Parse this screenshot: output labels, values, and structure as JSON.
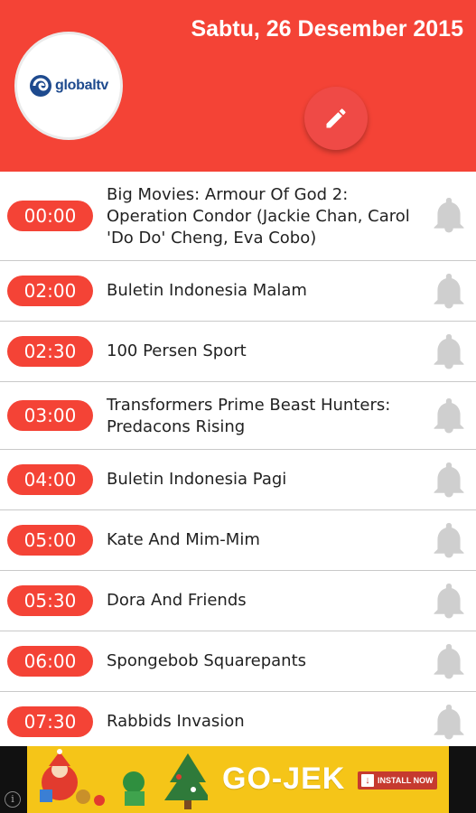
{
  "header": {
    "date": "Sabtu, 26 Desember 2015",
    "channel_logo": "globaltv",
    "edit_icon": "pencil-icon",
    "color": "#f44336"
  },
  "schedule": [
    {
      "time": "00:00",
      "title": "Big Movies: Armour Of God 2: Operation Condor (Jackie Chan, Carol 'Do Do' Cheng, Eva Cobo)"
    },
    {
      "time": "02:00",
      "title": "Buletin Indonesia Malam"
    },
    {
      "time": "02:30",
      "title": "100 Persen Sport"
    },
    {
      "time": "03:00",
      "title": "Transformers Prime Beast Hunters: Predacons Rising"
    },
    {
      "time": "04:00",
      "title": "Buletin Indonesia Pagi"
    },
    {
      "time": "05:00",
      "title": "Kate And Mim-Mim"
    },
    {
      "time": "05:30",
      "title": "Dora And Friends"
    },
    {
      "time": "06:00",
      "title": "Spongebob Squarepants"
    },
    {
      "time": "07:30",
      "title": "Rabbids Invasion"
    }
  ],
  "ad": {
    "brand": "GO-JEK",
    "install_label": "INSTALL NOW",
    "info_icon": "i"
  }
}
